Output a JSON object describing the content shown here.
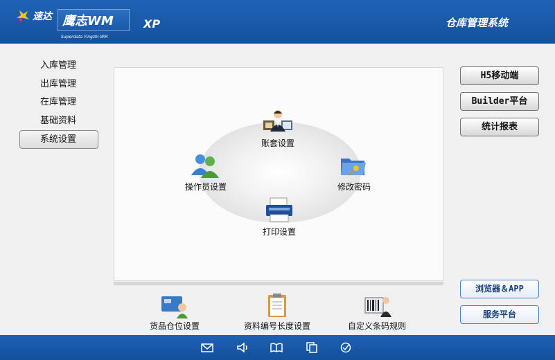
{
  "header": {
    "brand_cn": "速达",
    "product_name": "鹰志WM",
    "product_sub": "Superdata Yingzhi WM",
    "version": "XP",
    "system_title": "仓库管理系统"
  },
  "sidebar": {
    "items": [
      {
        "label": "入库管理"
      },
      {
        "label": "出库管理"
      },
      {
        "label": "在库管理"
      },
      {
        "label": "基础资料"
      },
      {
        "label": "系统设置",
        "active": true
      }
    ]
  },
  "main": {
    "functions": [
      {
        "label": "账套设置",
        "icon": "account-set-icon"
      },
      {
        "label": "操作员设置",
        "icon": "operators-icon"
      },
      {
        "label": "修改密码",
        "icon": "folder-key-icon"
      },
      {
        "label": "打印设置",
        "icon": "printer-icon"
      }
    ],
    "shortcuts": [
      {
        "label": "货品仓位设置",
        "icon": "location-card-icon"
      },
      {
        "label": "资料编号长度设置",
        "icon": "clipboard-icon"
      },
      {
        "label": "自定义条码规则",
        "icon": "barcode-person-icon"
      }
    ]
  },
  "right_buttons": [
    {
      "label": "H5移动端"
    },
    {
      "label": "Builder平台"
    },
    {
      "label": "统计报表"
    }
  ],
  "right_blue_buttons": [
    {
      "label": "浏览器＆APP"
    },
    {
      "label": "服务平台"
    }
  ],
  "footer": {
    "icons": [
      "mail-icon",
      "speaker-icon",
      "book-icon",
      "copy-icon",
      "check-circle-icon"
    ]
  },
  "colors": {
    "header_blue": "#1f63b6",
    "footer_blue": "#1d61b4",
    "panel_bg": "#fbfbfb"
  }
}
